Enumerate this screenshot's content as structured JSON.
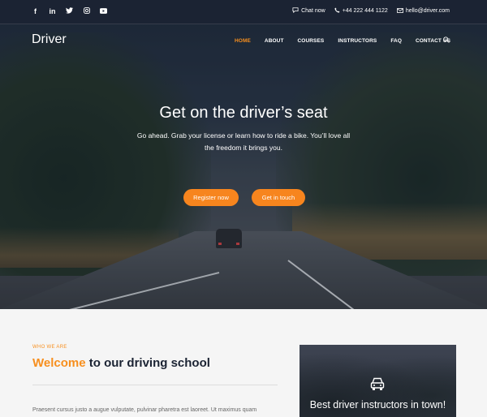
{
  "topbar": {
    "social_icons": [
      "facebook-icon",
      "linkedin-icon",
      "twitter-icon",
      "instagram-icon",
      "youtube-icon"
    ],
    "chat_label": "Chat now",
    "phone": "+44 222 444 1122",
    "email": "hello@driver.com"
  },
  "nav": {
    "brand": "Driver",
    "items": [
      "HOME",
      "ABOUT",
      "COURSES",
      "INSTRUCTORS",
      "FAQ",
      "CONTACT US"
    ],
    "active": "HOME"
  },
  "hero": {
    "title": "Get on the driver’s seat",
    "subtitle": "Go ahead. Grab your license or learn how to ride a bike. You’ll love all the freedom it brings you.",
    "primary_button": "Register now",
    "secondary_button": "Get in touch"
  },
  "about": {
    "eyebrow": "WHO WE ARE",
    "title_accent": "Welcome",
    "title_rest": " to our driving school",
    "body": "Praesent cursus justo a augue vulputate, pulvinar pharetra est laoreet. Ut maximus quam"
  },
  "card": {
    "icon": "car-icon",
    "title": "Best driver instructors in town!"
  },
  "colors": {
    "accent": "#f78f1e",
    "dark": "#1b2333"
  }
}
